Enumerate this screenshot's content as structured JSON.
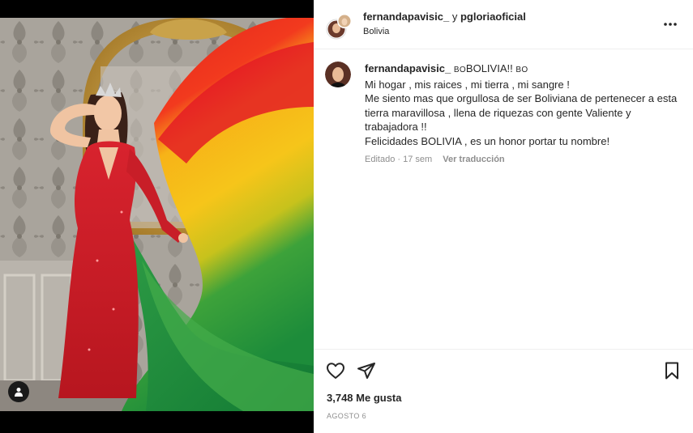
{
  "post": {
    "author": "fernandapavisic_",
    "connector": "y",
    "coauthor": "pgloriaoficial",
    "location": "Bolivia",
    "caption_username": "fernandapavisic_",
    "caption_title": "BOLIVIA!!",
    "flag_code": "BO",
    "caption_lines": [
      "Mi hogar , mis raices , mi tierra , mi sangre !",
      "Me siento mas que orgullosa de ser Boliviana de pertenecer a esta tierra maravillosa , llena de riquezas con gente Valiente y trabajadora !!",
      "Felicidades BOLIVIA , es un honor portar tu nombre!"
    ],
    "edited_label": "Editado · 17 sem",
    "translate_label": "Ver traducción",
    "likes": "3,748 Me gusta",
    "date": "Agosto 6"
  },
  "icons": {
    "more": "more-options-icon",
    "like": "heart-icon",
    "share": "paper-plane-icon",
    "save": "bookmark-icon",
    "user_tag": "user-tag-icon"
  },
  "colors": {
    "flag_red": "#d52b1e",
    "flag_yellow": "#f9e300",
    "flag_green": "#007934",
    "dress_red": "#c81e28",
    "muted_text": "#8e8e8e",
    "border": "#efefef"
  }
}
